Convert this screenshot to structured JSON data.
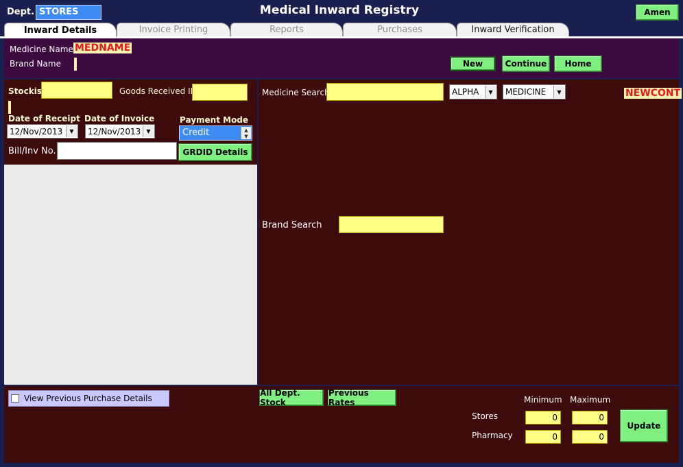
{
  "header": {
    "dept_label": "Dept.",
    "dept_value": "STORES",
    "title": "Medical Inward Registry",
    "user_button": "Amen"
  },
  "tabs": [
    {
      "label": "Inward Details",
      "active": true
    },
    {
      "label": "Invoice Printing",
      "active": false
    },
    {
      "label": "Reports",
      "active": false
    },
    {
      "label": "Purchases",
      "active": false
    },
    {
      "label": "Inward Verification",
      "active": false
    }
  ],
  "top_panel": {
    "medicine_name_label": "Medicine Name",
    "medicine_name_value": "MEDNAME",
    "brand_name_label": "Brand Name",
    "buttons": {
      "new": "New",
      "continue": "Continue",
      "home": "Home"
    }
  },
  "left_panel": {
    "stockist_label": "Stockist",
    "grn_label": "Goods Received ID:",
    "date_receipt_label": "Date of Receipt",
    "date_receipt_value": "12/Nov/2013",
    "date_invoice_label": "Date of Invoice",
    "date_invoice_value": "12/Nov/2013",
    "payment_mode_label": "Payment Mode",
    "payment_mode_value": "Credit",
    "bill_label": "Bill/Inv No.",
    "grdid_button": "GRDID Details"
  },
  "right_panel": {
    "medicine_search_label": "Medicine Search",
    "sort_select": "ALPHA",
    "type_select": "MEDICINE",
    "newcont_tag": "NEWCONT",
    "brand_search_label": "Brand Search"
  },
  "bottom_panel": {
    "view_prev_label": "View Previous Purchase Details",
    "all_dept_button": "All Dept. Stock",
    "prev_rates_button": "Previous Rates",
    "minimum_label": "Minimum",
    "maximum_label": "Maximum",
    "stores_label": "Stores",
    "pharmacy_label": "Pharmacy",
    "stores_min": "0",
    "stores_max": "0",
    "pharmacy_min": "0",
    "pharmacy_max": "0",
    "update_button": "Update"
  },
  "colors": {
    "frame": "#1b1f4f",
    "maroon": "#3d0b0b",
    "purple": "#3c0a3f",
    "input_yellow": "#ffff88",
    "button_green": "#7ff07f",
    "dept_blue": "#3d8cf5"
  },
  "icons": {
    "dropdown": "chevron-down-icon",
    "spin_up": "arrow-up-icon",
    "spin_down": "arrow-down-icon"
  }
}
